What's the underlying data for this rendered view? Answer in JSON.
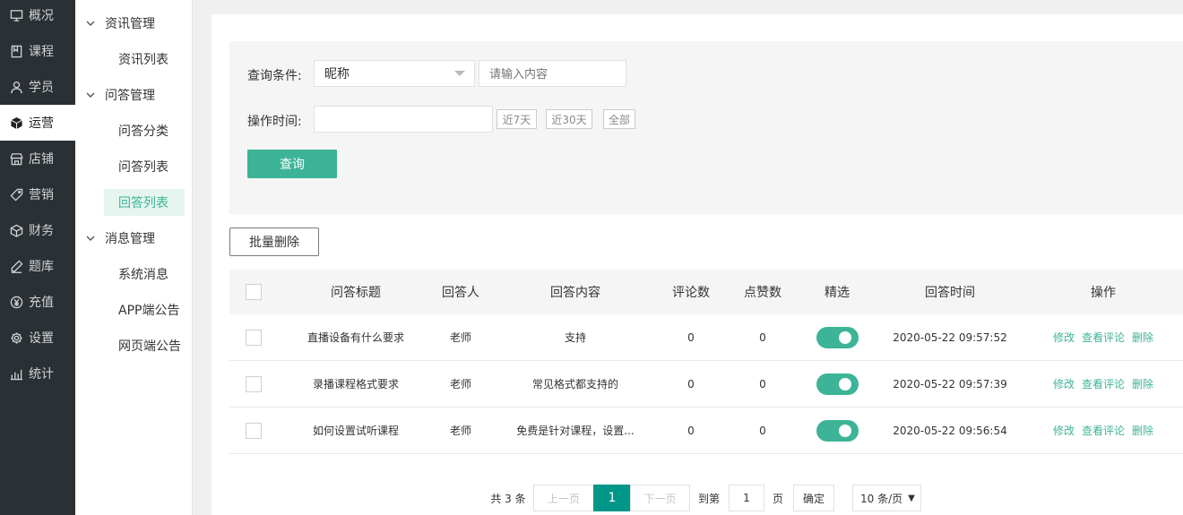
{
  "nav": {
    "items": [
      {
        "label": "概况",
        "icon": "monitor-icon"
      },
      {
        "label": "课程",
        "icon": "book-icon"
      },
      {
        "label": "学员",
        "icon": "user-icon"
      },
      {
        "label": "运营",
        "icon": "cube-icon",
        "active": true
      },
      {
        "label": "店铺",
        "icon": "store-icon"
      },
      {
        "label": "营销",
        "icon": "tag-icon"
      },
      {
        "label": "财务",
        "icon": "box-icon"
      },
      {
        "label": "题库",
        "icon": "pen-icon"
      },
      {
        "label": "充值",
        "icon": "yen-icon"
      },
      {
        "label": "设置",
        "icon": "gear-icon"
      },
      {
        "label": "统计",
        "icon": "chart-icon"
      }
    ]
  },
  "submenu": {
    "groups": [
      {
        "label": "资讯管理",
        "items": [
          "资讯列表"
        ]
      },
      {
        "label": "问答管理",
        "items": [
          "问答分类",
          "问答列表",
          "回答列表"
        ]
      },
      {
        "label": "消息管理",
        "items": [
          "系统消息",
          "APP端公告",
          "网页端公告"
        ]
      }
    ],
    "active": "回答列表"
  },
  "filter": {
    "condition_label": "查询条件:",
    "condition_value": "昵称",
    "keyword_placeholder": "请输入内容",
    "time_label": "操作时间:",
    "quick": [
      "近7天",
      "近30天",
      "全部"
    ],
    "search_label": "查询"
  },
  "bulk_delete_label": "批量删除",
  "table": {
    "headers": [
      "问答标题",
      "回答人",
      "回答内容",
      "评论数",
      "点赞数",
      "精选",
      "回答时间",
      "操作"
    ],
    "rows": [
      {
        "title": "直播设备有什么要求",
        "user": "老师",
        "content": "支持",
        "comments": "0",
        "likes": "0",
        "featured": true,
        "time": "2020-05-22 09:57:52"
      },
      {
        "title": "录播课程格式要求",
        "user": "老师",
        "content": "常见格式都支持的",
        "comments": "0",
        "likes": "0",
        "featured": true,
        "time": "2020-05-22 09:57:39"
      },
      {
        "title": "如何设置试听课程",
        "user": "老师",
        "content": "免费是针对课程，设置...",
        "comments": "0",
        "likes": "0",
        "featured": true,
        "time": "2020-05-22 09:56:54"
      }
    ],
    "actions": [
      "修改",
      "查看评论",
      "删除"
    ]
  },
  "pagination": {
    "total_text": "共 3 条",
    "prev": "上一页",
    "current": "1",
    "next": "下一页",
    "goto_label": "到第",
    "goto_value": "1",
    "page_label": "页",
    "confirm": "确定",
    "page_size": "10 条/页"
  },
  "colors": {
    "accent": "#3db497",
    "nav_bg": "#2b3034",
    "page_active": "#009688"
  }
}
